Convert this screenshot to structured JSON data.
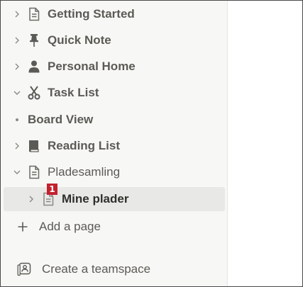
{
  "sidebar": {
    "items": [
      {
        "label": "Getting Started",
        "icon": "document-icon",
        "expanded": false
      },
      {
        "label": "Quick Note",
        "icon": "pin-icon",
        "expanded": false
      },
      {
        "label": "Personal Home",
        "icon": "person-icon",
        "expanded": false
      },
      {
        "label": "Task List",
        "icon": "scissors-icon",
        "expanded": true
      },
      {
        "label": "Board View",
        "icon": "bullet-icon"
      },
      {
        "label": "Reading List",
        "icon": "book-icon",
        "expanded": false
      },
      {
        "label": "Pladesamling",
        "icon": "document-icon",
        "expanded": true
      },
      {
        "label": "Mine plader",
        "icon": "document-icon",
        "expanded": false,
        "selected": true
      }
    ],
    "add_page_label": "Add a page",
    "create_teamspace_label": "Create a teamspace"
  },
  "annotation": {
    "badge_number": "1",
    "badge_color": "#c4202e"
  },
  "colors": {
    "sidebar_bg": "#f7f7f5",
    "text": "#5b5a56",
    "selected_bg": "#e8e8e6"
  }
}
